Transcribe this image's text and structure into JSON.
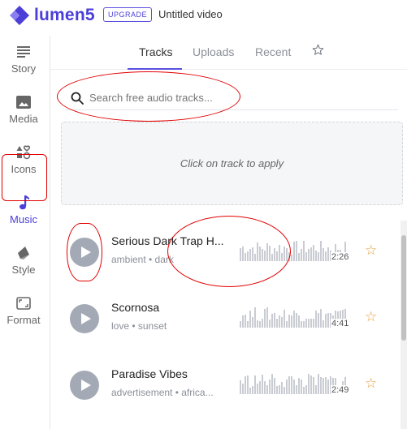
{
  "header": {
    "logo_text": "lumen5",
    "upgrade_label": "UPGRADE",
    "video_title": "Untitled video",
    "brand_color": "#4b3fd8"
  },
  "sidebar": {
    "items": [
      {
        "label": "Story",
        "icon": "story-icon"
      },
      {
        "label": "Media",
        "icon": "image-icon"
      },
      {
        "label": "Icons",
        "icon": "shapes-icon"
      },
      {
        "label": "Music",
        "icon": "music-note-icon",
        "active": true
      },
      {
        "label": "Style",
        "icon": "style-icon"
      },
      {
        "label": "Format",
        "icon": "format-icon"
      }
    ]
  },
  "tabs": [
    {
      "label": "Tracks",
      "active": true
    },
    {
      "label": "Uploads"
    },
    {
      "label": "Recent"
    },
    {
      "label": "",
      "icon": "star-outline-icon"
    }
  ],
  "search": {
    "placeholder": "Search free audio tracks..."
  },
  "dropzone": {
    "text": "Click on track to apply"
  },
  "tracks": [
    {
      "title": "Serious Dark Trap H...",
      "tags": "ambient • dark",
      "duration": "2:26"
    },
    {
      "title": "Scornosa",
      "tags": "love • sunset",
      "duration": "4:41"
    },
    {
      "title": "Paradise Vibes",
      "tags": "advertisement • africa...",
      "duration": "2:49"
    }
  ],
  "annotation_color": "#e10000"
}
